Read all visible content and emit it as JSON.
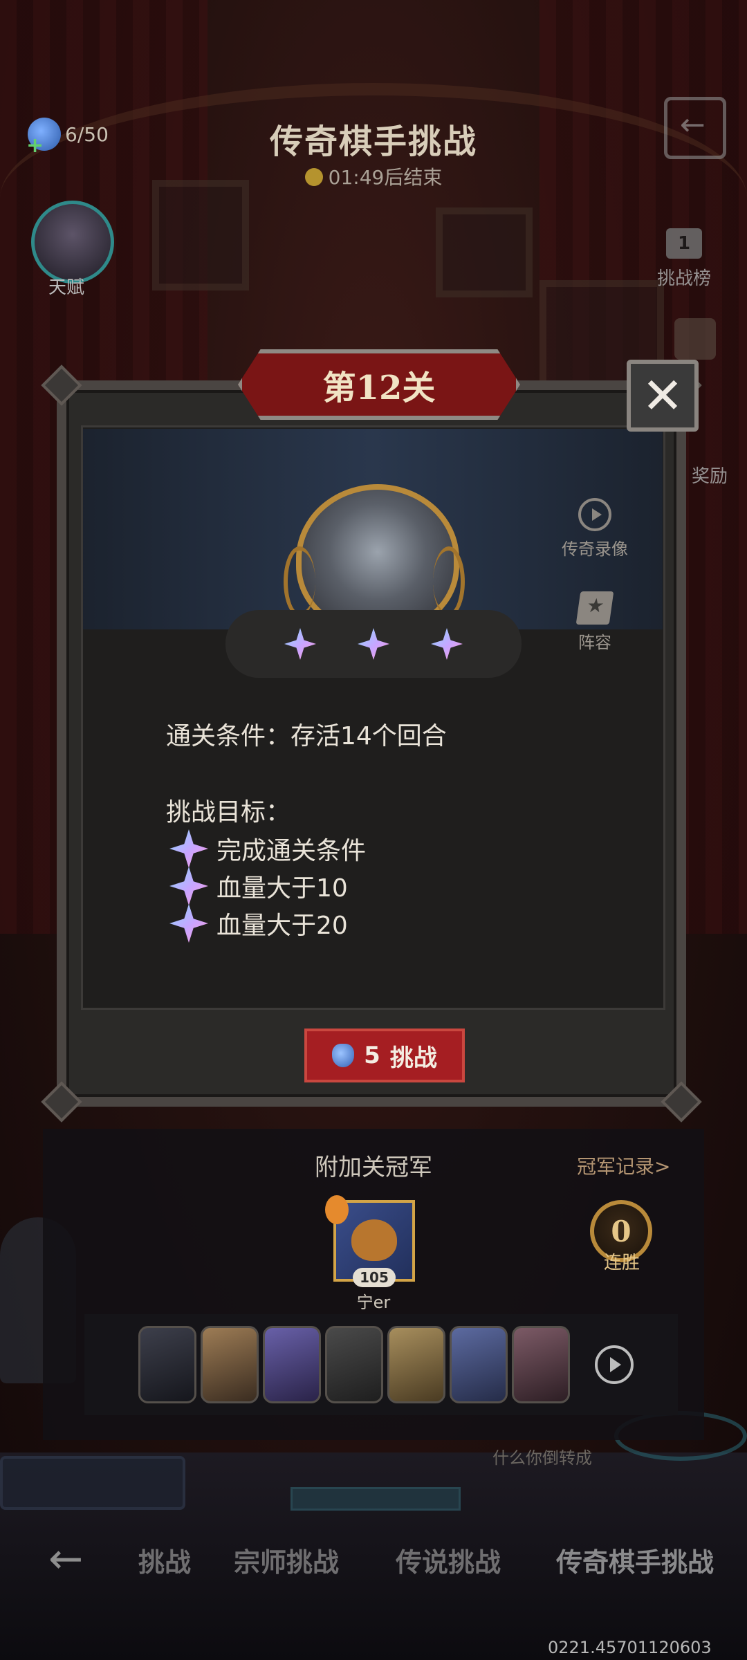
{
  "hud": {
    "energy": "6/50",
    "title": "传奇棋手挑战",
    "timer": "01:49后结束",
    "talent_label": "天赋",
    "rank_button_label": "挑战榜",
    "rank_number": "1",
    "reward_label": "奖励"
  },
  "modal": {
    "title": "第12关",
    "close_label": "✕",
    "replay_label": "传奇录像",
    "lineup_label": "阵容",
    "star_count": 3,
    "condition": "通关条件：存活14个回合",
    "goals_heading": "挑战目标：",
    "goals": [
      "完成通关条件",
      "血量大于10",
      "血量大于20"
    ],
    "challenge_cost": "5",
    "challenge_label": "挑战"
  },
  "champion": {
    "title": "附加关冠军",
    "record_link": "冠军记录>",
    "level": "105",
    "name": "宁er",
    "streak_count": "0",
    "streak_label": "连胜"
  },
  "background": {
    "faint_text": "什么你倒转成"
  },
  "nav": {
    "tabs": [
      "挑战",
      "宗师挑战",
      "传说挑战",
      "传奇棋手挑战"
    ],
    "back_icon": "back-arrow-icon"
  },
  "footer": {
    "version": "0221.45701120603"
  }
}
